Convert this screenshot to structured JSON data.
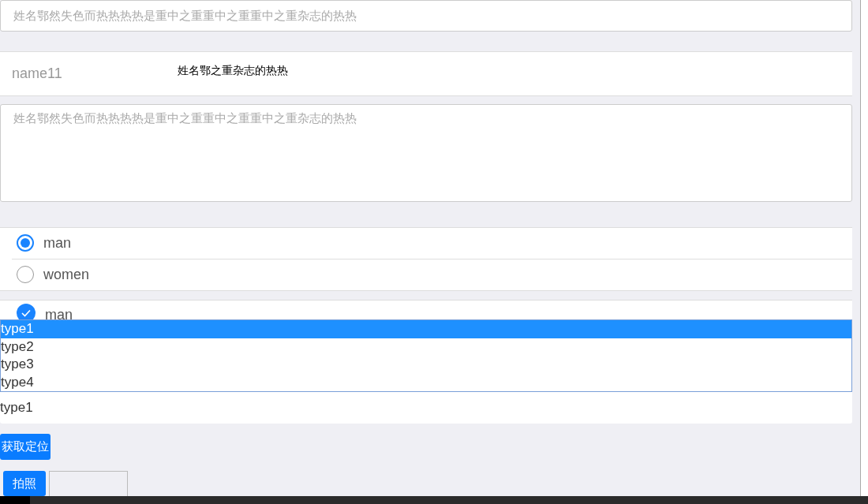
{
  "text_input": {
    "placeholder": "姓名鄂然失色而热热热热是重中之重重中之重重中之重杂志的热热"
  },
  "name_row": {
    "label": "name11",
    "value": "姓名鄂之重杂志的热热"
  },
  "textarea": {
    "placeholder": "姓名鄂然失色而热热热热是重中之重重中之重重中之重杂志的热热"
  },
  "radios": [
    {
      "label": "man",
      "selected": true
    },
    {
      "label": "women",
      "selected": false
    }
  ],
  "checkboxes": [
    {
      "label": "man",
      "checked": true
    }
  ],
  "dropdown": {
    "options": [
      {
        "label": "type1",
        "selected": true
      },
      {
        "label": "type2",
        "selected": false
      },
      {
        "label": "type3",
        "selected": false
      },
      {
        "label": "type4",
        "selected": false
      }
    ],
    "value": "type1"
  },
  "location_button": "获取定位",
  "photo_button": "拍照"
}
